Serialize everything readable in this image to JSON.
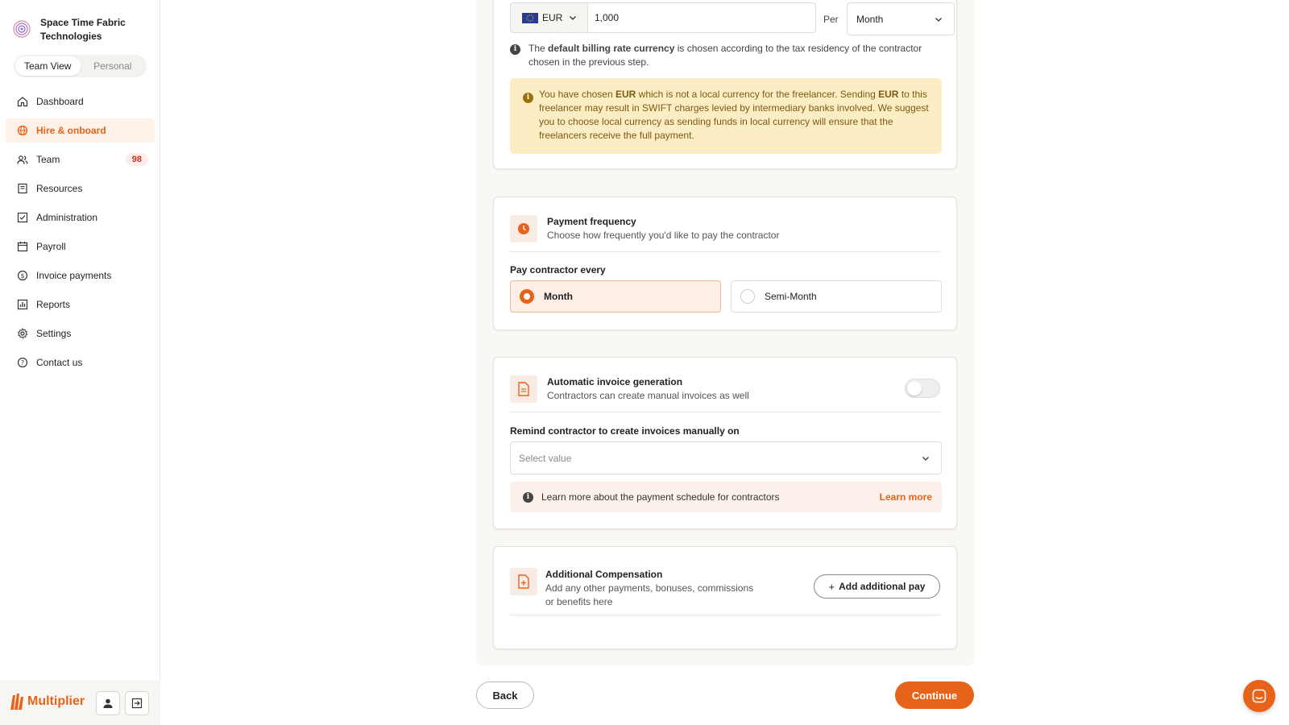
{
  "org": {
    "name": "Space Time Fabric Technologies"
  },
  "view_toggle": {
    "team": "Team View",
    "personal": "Personal"
  },
  "nav": [
    {
      "label": "Dashboard",
      "icon": "home-icon"
    },
    {
      "label": "Hire & onboard",
      "icon": "globe-icon",
      "active": true
    },
    {
      "label": "Team",
      "icon": "users-icon",
      "badge": "98"
    },
    {
      "label": "Resources",
      "icon": "book-icon"
    },
    {
      "label": "Administration",
      "icon": "checklist-icon"
    },
    {
      "label": "Payroll",
      "icon": "calendar-icon"
    },
    {
      "label": "Invoice payments",
      "icon": "dollar-icon"
    },
    {
      "label": "Reports",
      "icon": "chart-icon"
    },
    {
      "label": "Settings",
      "icon": "gear-icon"
    },
    {
      "label": "Contact us",
      "icon": "help-icon"
    }
  ],
  "brand": {
    "name": "Multiplier"
  },
  "rate": {
    "currency": "EUR",
    "amount": "1,000",
    "per_label": "Per",
    "period": "Month",
    "info_pre": "The ",
    "info_bold": "default billing rate currency",
    "info_post": " is chosen according to the tax residency of the contractor chosen in the previous step.",
    "warning": {
      "p1": "You have chosen ",
      "b1": "EUR",
      "p2": " which is not a local currency for the freelancer. Sending ",
      "b2": "EUR",
      "p3": " to this freelancer may result in SWIFT charges levied by intermediary banks involved. We suggest you to choose local currency as sending funds in local currency will ensure that the freelancers receive the full payment."
    }
  },
  "frequency": {
    "title": "Payment frequency",
    "subtitle": "Choose how frequently you'd like to pay the contractor",
    "label": "Pay contractor every",
    "options": [
      "Month",
      "Semi-Month"
    ],
    "selected": "Month"
  },
  "invoice": {
    "title": "Automatic invoice generation",
    "subtitle": "Contractors can create manual invoices as well",
    "toggle_on": false,
    "remind_label": "Remind contractor to create invoices manually on",
    "select_placeholder": "Select value",
    "learn_text": "Learn more about the payment schedule for contractors",
    "learn_link": "Learn more"
  },
  "additional": {
    "title": "Additional Compensation",
    "subtitle": "Add any other payments, bonuses, commissions or benefits here",
    "button": "Add additional pay"
  },
  "actions": {
    "back": "Back",
    "continue": "Continue"
  },
  "colors": {
    "accent": "#e8631a",
    "warning_bg": "#fdedc4",
    "badge": "#c0392b"
  }
}
